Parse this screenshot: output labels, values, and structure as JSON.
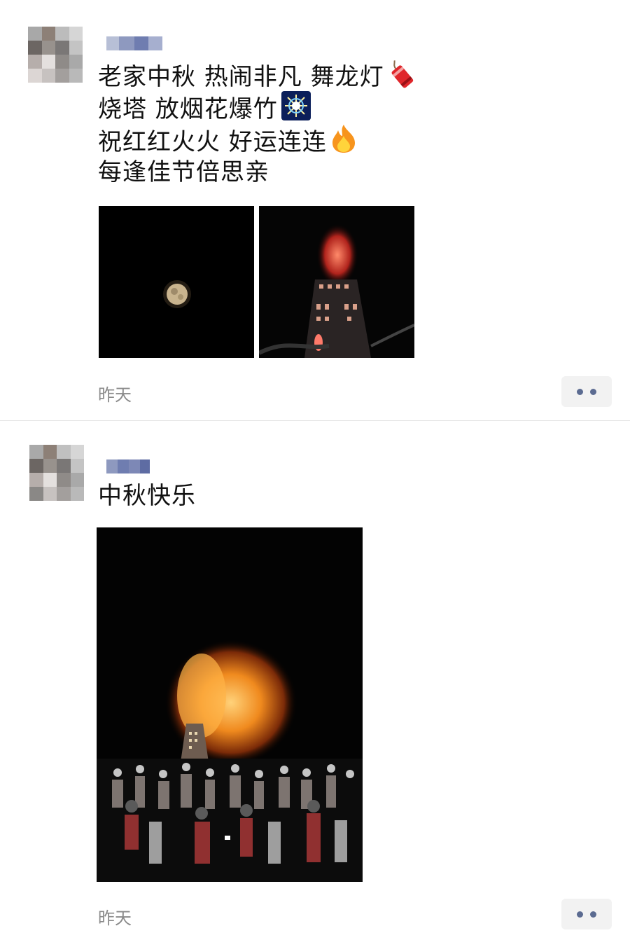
{
  "posts": [
    {
      "text_lines": [
        "老家中秋 热闹非凡 舞龙灯",
        "烧塔 放烟花爆竹",
        "祝红红火火 好运连连",
        "每逢佳节倍思亲"
      ],
      "emojis": [
        "firecracker-emoji",
        "fireworks-emoji",
        "fire-emoji"
      ],
      "images": [
        "full-moon-night-photo",
        "burning-tower-photo"
      ],
      "time": "昨天"
    },
    {
      "text_lines": [
        "中秋快乐"
      ],
      "images": [
        "crowd-watching-burning-tower-photo"
      ],
      "time": "昨天"
    }
  ],
  "colors": {
    "time_text": "#8a8a8a",
    "more_dots": "#5b6b91",
    "more_bg": "#f2f2f2"
  }
}
